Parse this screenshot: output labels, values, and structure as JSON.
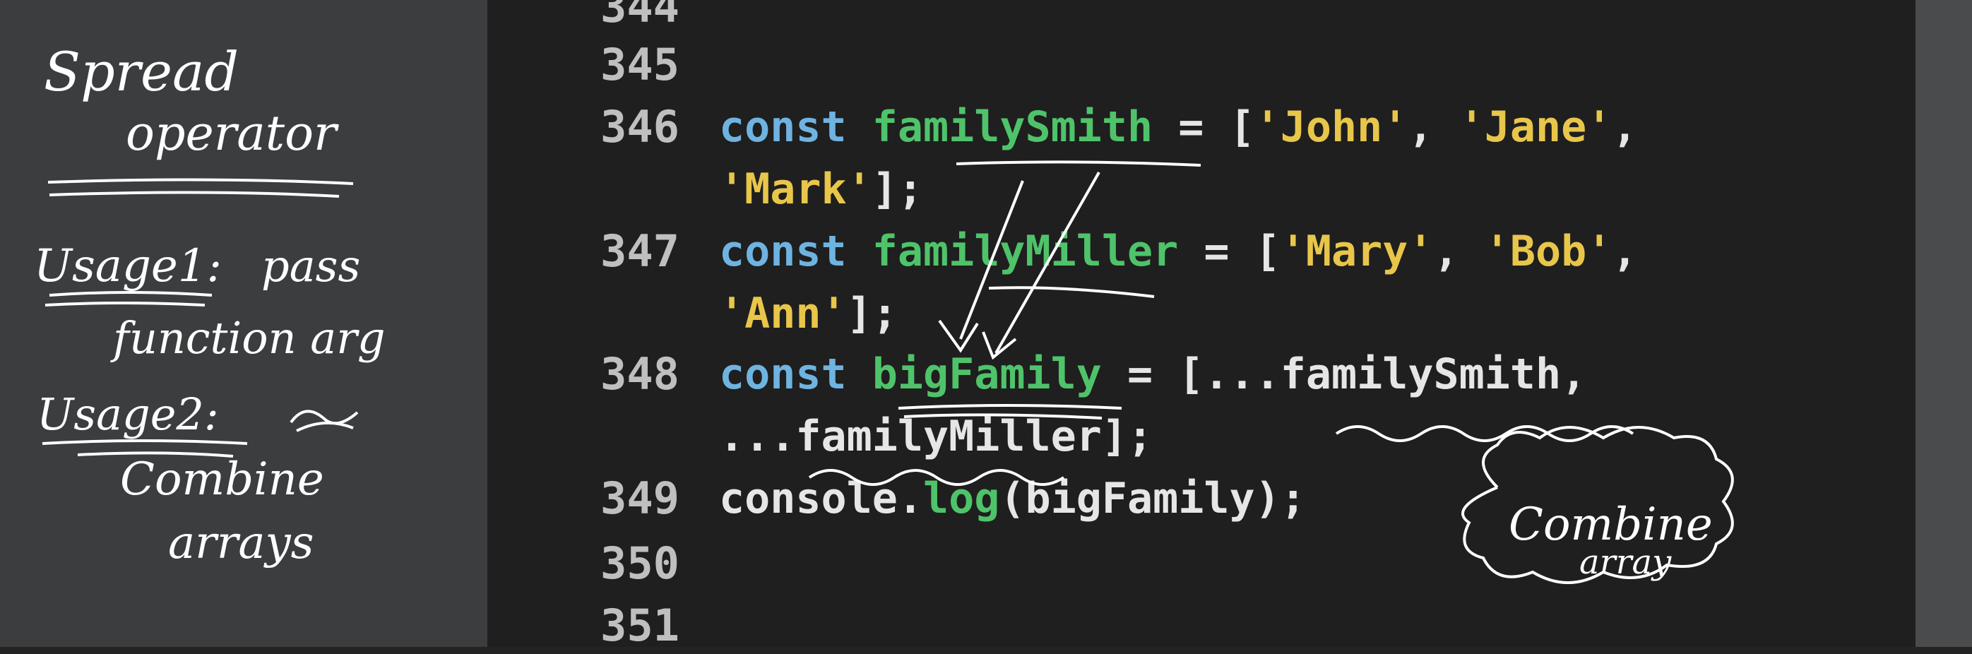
{
  "notes": {
    "title_line1": "Spread",
    "title_line2": "operator",
    "usage1_label": "Usage1:",
    "usage1_text1": "pass",
    "usage1_text2": "function arg",
    "usage2_label": "Usage2:",
    "usage2_text1": "Combine",
    "usage2_text2": "arrays"
  },
  "editor": {
    "line_numbers": [
      "344",
      "345",
      "346",
      "347",
      "348",
      "349",
      "350",
      "351"
    ],
    "line346": {
      "kw": "const",
      "var": "familySmith",
      "op": " = [",
      "s1": "'John'",
      "c1": ", ",
      "s2": "'Jane'",
      "c2": ",",
      "s3": "'Mark'",
      "end": "];"
    },
    "line347": {
      "kw": "const",
      "var": "familyMiller",
      "op": " = [",
      "s1": "'Mary'",
      "c1": ", ",
      "s2": "'Bob'",
      "c2": ",",
      "s3": "'Ann'",
      "end": "];"
    },
    "line348": {
      "kw": "const",
      "var": "bigFamily",
      "rest1": " = [...familySmith,",
      "rest2": "...familyMiller];"
    },
    "line349": {
      "obj": "console.",
      "fn": "log",
      "args": "(bigFamily);"
    }
  },
  "annotation": {
    "bubble_line1": "Combine",
    "bubble_line2": "array"
  }
}
